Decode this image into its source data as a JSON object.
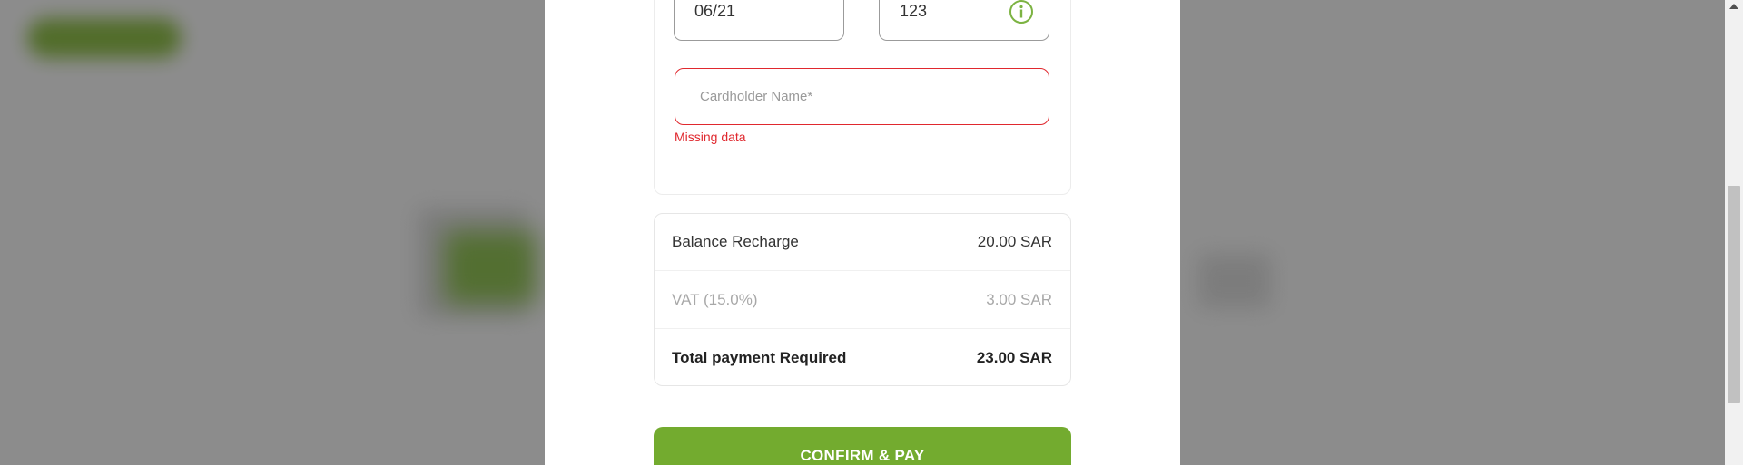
{
  "card_form": {
    "expiry_value": "06/21",
    "cvv_value": "123",
    "cvv_info_icon": "info-circle-icon",
    "cardholder_placeholder": "Cardholder Name*",
    "cardholder_value": "",
    "cardholder_error": "Missing data"
  },
  "summary": {
    "rows": [
      {
        "label": "Balance Recharge",
        "value": "20.00 SAR"
      },
      {
        "label": "VAT (15.0%)",
        "value": "3.00 SAR"
      },
      {
        "label": "Total payment Required",
        "value": "23.00 SAR"
      }
    ]
  },
  "actions": {
    "confirm_label": "CONFIRM & PAY"
  },
  "colors": {
    "accent_green": "#73ab2f",
    "error_red": "#e0282e",
    "info_icon_green": "#7cb342"
  }
}
